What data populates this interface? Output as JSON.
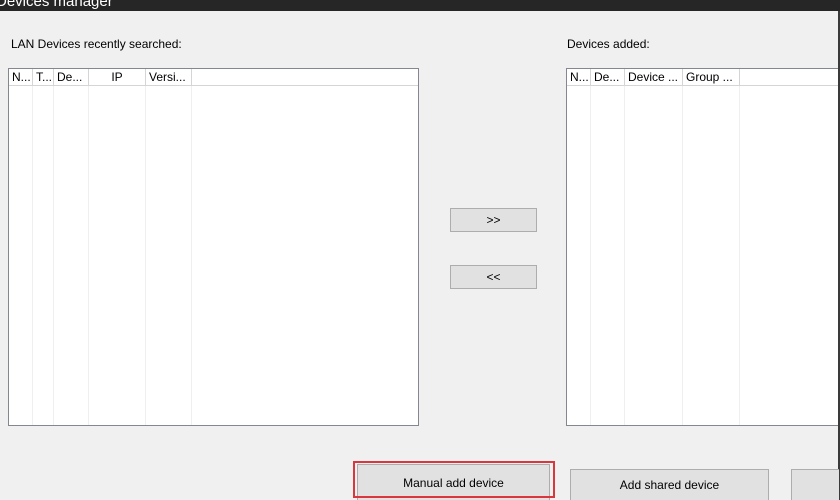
{
  "window": {
    "title": "Devices manager"
  },
  "left_panel": {
    "label": "LAN Devices recently searched:",
    "columns": [
      "N...",
      "T...",
      "De...",
      "IP",
      "Versi..."
    ]
  },
  "right_panel": {
    "label": "Devices added:",
    "columns": [
      "N...",
      "De...",
      "Device ...",
      "Group ..."
    ]
  },
  "transfer": {
    "add_label": ">>",
    "remove_label": "<<"
  },
  "footer": {
    "manual_add_label": "Manual add device",
    "add_shared_label": "Add shared device"
  },
  "colors": {
    "highlight": "#d9363e",
    "titlebar": "#262626"
  }
}
